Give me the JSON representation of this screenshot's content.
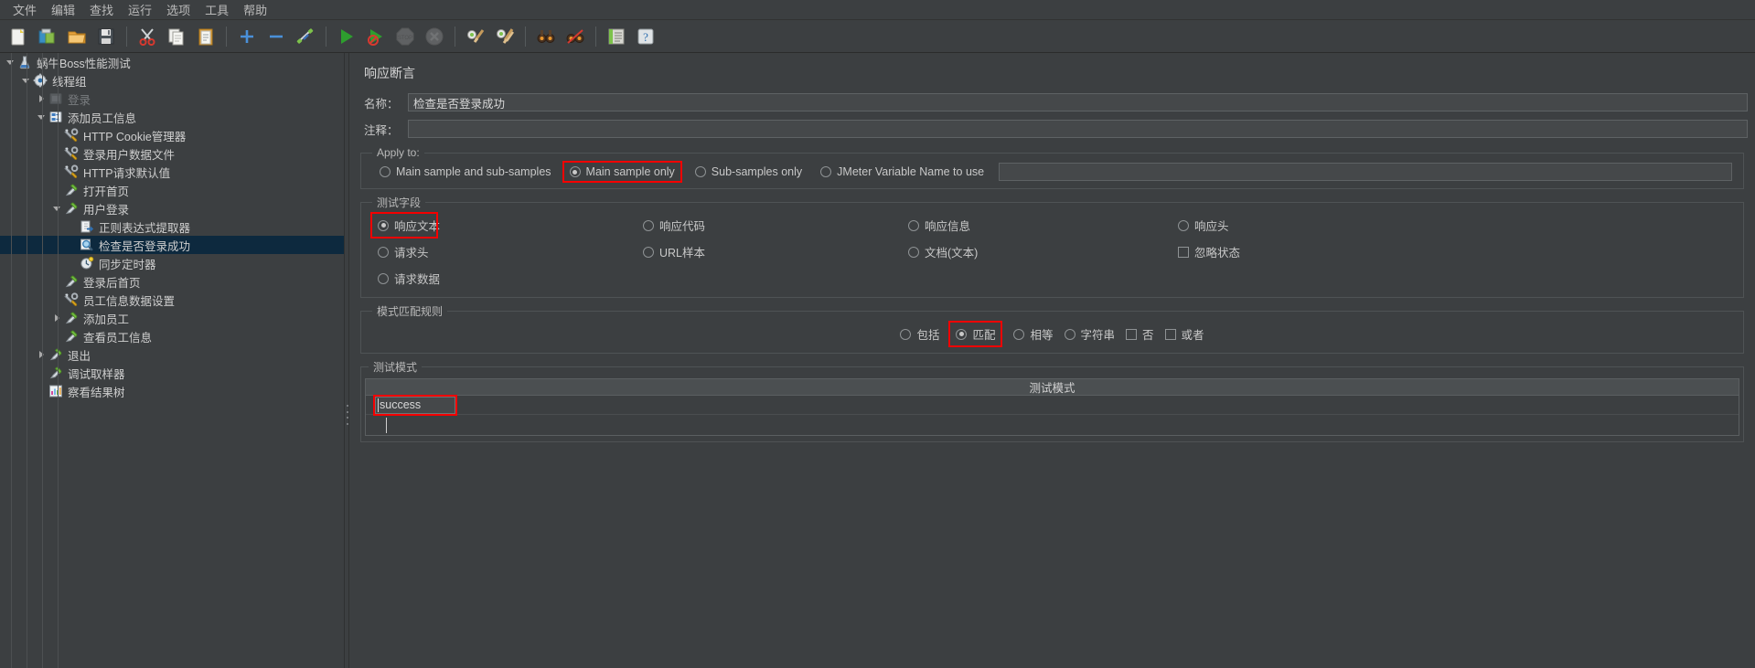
{
  "window": {
    "theme_bg": "#3c3f41",
    "accent_highlight": "#f50000",
    "selection_bg": "#0d293e"
  },
  "menubar": {
    "items": [
      {
        "label": "文件",
        "name": "menu-file"
      },
      {
        "label": "编辑",
        "name": "menu-edit"
      },
      {
        "label": "查找",
        "name": "menu-search"
      },
      {
        "label": "运行",
        "name": "menu-run"
      },
      {
        "label": "选项",
        "name": "menu-options"
      },
      {
        "label": "工具",
        "name": "menu-tools"
      },
      {
        "label": "帮助",
        "name": "menu-help"
      }
    ]
  },
  "toolbar": {
    "buttons": [
      {
        "icon": "new-file-icon",
        "title": "新建"
      },
      {
        "icon": "templates-icon",
        "title": "模板"
      },
      {
        "icon": "open-folder-icon",
        "title": "打开"
      },
      {
        "icon": "save-icon",
        "title": "保存"
      },
      {
        "sep": true
      },
      {
        "icon": "cut-scissors-icon",
        "title": "剪切"
      },
      {
        "icon": "copy-icon",
        "title": "复制"
      },
      {
        "icon": "paste-clipboard-icon",
        "title": "粘贴"
      },
      {
        "sep": true
      },
      {
        "icon": "expand-plus-icon",
        "title": "展开全部"
      },
      {
        "icon": "collapse-minus-icon",
        "title": "收起全部"
      },
      {
        "icon": "toggle-enable-icon",
        "title": "启用/禁用"
      },
      {
        "sep": true
      },
      {
        "icon": "run-start-icon",
        "title": "启动"
      },
      {
        "icon": "run-no-timers-icon",
        "title": "无间隔启动"
      },
      {
        "icon": "stop-icon",
        "title": "停止",
        "disabled": true
      },
      {
        "icon": "shutdown-icon",
        "title": "关闭",
        "disabled": true
      },
      {
        "sep": true
      },
      {
        "icon": "clear-icon",
        "title": "清除"
      },
      {
        "icon": "clear-all-icon",
        "title": "清除全部"
      },
      {
        "sep": true
      },
      {
        "icon": "search-binoculars-icon",
        "title": "查找"
      },
      {
        "icon": "reset-search-icon",
        "title": "重置查找"
      },
      {
        "sep": true
      },
      {
        "icon": "function-helper-icon",
        "title": "函数助手对话框"
      },
      {
        "icon": "help-icon",
        "title": "帮助"
      }
    ]
  },
  "tree": {
    "nodes": [
      {
        "label": "蜗牛Boss性能测试",
        "icon": "test-plan-icon",
        "depth": 0,
        "arrow": "open",
        "selected": false,
        "disabled": false
      },
      {
        "label": "线程组",
        "icon": "thread-group-icon",
        "depth": 1,
        "arrow": "open",
        "selected": false,
        "disabled": false
      },
      {
        "label": "登录",
        "icon": "controller-disabled-icon",
        "depth": 2,
        "arrow": "closed",
        "selected": false,
        "disabled": true
      },
      {
        "label": "添加员工信息",
        "icon": "transaction-controller-icon",
        "depth": 2,
        "arrow": "open",
        "selected": false,
        "disabled": false
      },
      {
        "label": "HTTP Cookie管理器",
        "icon": "config-element-icon",
        "depth": 3,
        "arrow": "none",
        "selected": false,
        "disabled": false
      },
      {
        "label": "登录用户数据文件",
        "icon": "config-element-icon",
        "depth": 3,
        "arrow": "none",
        "selected": false,
        "disabled": false
      },
      {
        "label": "HTTP请求默认值",
        "icon": "config-element-icon",
        "depth": 3,
        "arrow": "none",
        "selected": false,
        "disabled": false
      },
      {
        "label": "打开首页",
        "icon": "http-sampler-icon",
        "depth": 3,
        "arrow": "none",
        "selected": false,
        "disabled": false
      },
      {
        "label": "用户登录",
        "icon": "http-sampler-icon",
        "depth": 3,
        "arrow": "open",
        "selected": false,
        "disabled": false
      },
      {
        "label": "正则表达式提取器",
        "icon": "post-processor-icon",
        "depth": 4,
        "arrow": "none",
        "selected": false,
        "disabled": false
      },
      {
        "label": "检查是否登录成功",
        "icon": "assertion-icon",
        "depth": 4,
        "arrow": "none",
        "selected": true,
        "disabled": false
      },
      {
        "label": "同步定时器",
        "icon": "timer-icon",
        "depth": 4,
        "arrow": "none",
        "selected": false,
        "disabled": false
      },
      {
        "label": "登录后首页",
        "icon": "http-sampler-icon",
        "depth": 3,
        "arrow": "none",
        "selected": false,
        "disabled": false
      },
      {
        "label": "员工信息数据设置",
        "icon": "config-element-icon",
        "depth": 3,
        "arrow": "none",
        "selected": false,
        "disabled": false
      },
      {
        "label": "添加员工",
        "icon": "http-sampler-icon",
        "depth": 3,
        "arrow": "closed",
        "selected": false,
        "disabled": false
      },
      {
        "label": "查看员工信息",
        "icon": "http-sampler-icon",
        "depth": 3,
        "arrow": "none",
        "selected": false,
        "disabled": false
      },
      {
        "label": "退出",
        "icon": "http-sampler-icon",
        "depth": 2,
        "arrow": "closed",
        "selected": false,
        "disabled": false
      },
      {
        "label": "调试取样器",
        "icon": "http-sampler-icon",
        "depth": 2,
        "arrow": "none",
        "selected": false,
        "disabled": false
      },
      {
        "label": "察看结果树",
        "icon": "listener-icon",
        "depth": 2,
        "arrow": "none",
        "selected": false,
        "disabled": false
      }
    ]
  },
  "editor": {
    "title": "响应断言",
    "name_label": "名称：",
    "name_value": "检查是否登录成功",
    "name_placeholder": "",
    "comment_label": "注释：",
    "comment_value": "",
    "comment_placeholder": "",
    "apply_to": {
      "legend": "Apply to:",
      "options": [
        {
          "label": "Main sample and sub-samples",
          "selected": false,
          "highlight": false
        },
        {
          "label": "Main sample only",
          "selected": true,
          "highlight": true
        },
        {
          "label": "Sub-samples only",
          "selected": false,
          "highlight": false
        },
        {
          "label": "JMeter Variable Name to use",
          "selected": false,
          "highlight": false
        }
      ],
      "variable_value": "",
      "variable_placeholder": ""
    },
    "test_field": {
      "legend": "测试字段",
      "options": [
        {
          "label": "响应文本",
          "type": "radio",
          "selected": true,
          "highlight": true
        },
        {
          "label": "响应代码",
          "type": "radio",
          "selected": false,
          "highlight": false
        },
        {
          "label": "响应信息",
          "type": "radio",
          "selected": false,
          "highlight": false
        },
        {
          "label": "响应头",
          "type": "radio",
          "selected": false,
          "highlight": false
        },
        {
          "label": "请求头",
          "type": "radio",
          "selected": false,
          "highlight": false
        },
        {
          "label": "URL样本",
          "type": "radio",
          "selected": false,
          "highlight": false
        },
        {
          "label": "文档(文本)",
          "type": "radio",
          "selected": false,
          "highlight": false
        },
        {
          "label": "忽略状态",
          "type": "checkbox",
          "selected": false,
          "highlight": false
        },
        {
          "label": "请求数据",
          "type": "radio",
          "selected": false,
          "highlight": false
        },
        {
          "label": "",
          "type": "none",
          "selected": false,
          "highlight": false
        },
        {
          "label": "",
          "type": "none",
          "selected": false,
          "highlight": false
        },
        {
          "label": "",
          "type": "none",
          "selected": false,
          "highlight": false
        }
      ]
    },
    "pattern_rules": {
      "legend": "模式匹配规则",
      "options": [
        {
          "label": "包括",
          "type": "radio",
          "selected": false,
          "highlight": false
        },
        {
          "label": "匹配",
          "type": "radio",
          "selected": true,
          "highlight": true
        },
        {
          "label": "相等",
          "type": "radio",
          "selected": false,
          "highlight": false
        },
        {
          "label": "字符串",
          "type": "radio",
          "selected": false,
          "highlight": false
        },
        {
          "label": "否",
          "type": "checkbox",
          "selected": false,
          "highlight": false
        },
        {
          "label": "或者",
          "type": "checkbox",
          "selected": false,
          "highlight": false
        }
      ]
    },
    "test_patterns": {
      "legend": "测试模式",
      "column_header": "测试模式",
      "rows": [
        "success"
      ],
      "editing_value": "success"
    }
  }
}
